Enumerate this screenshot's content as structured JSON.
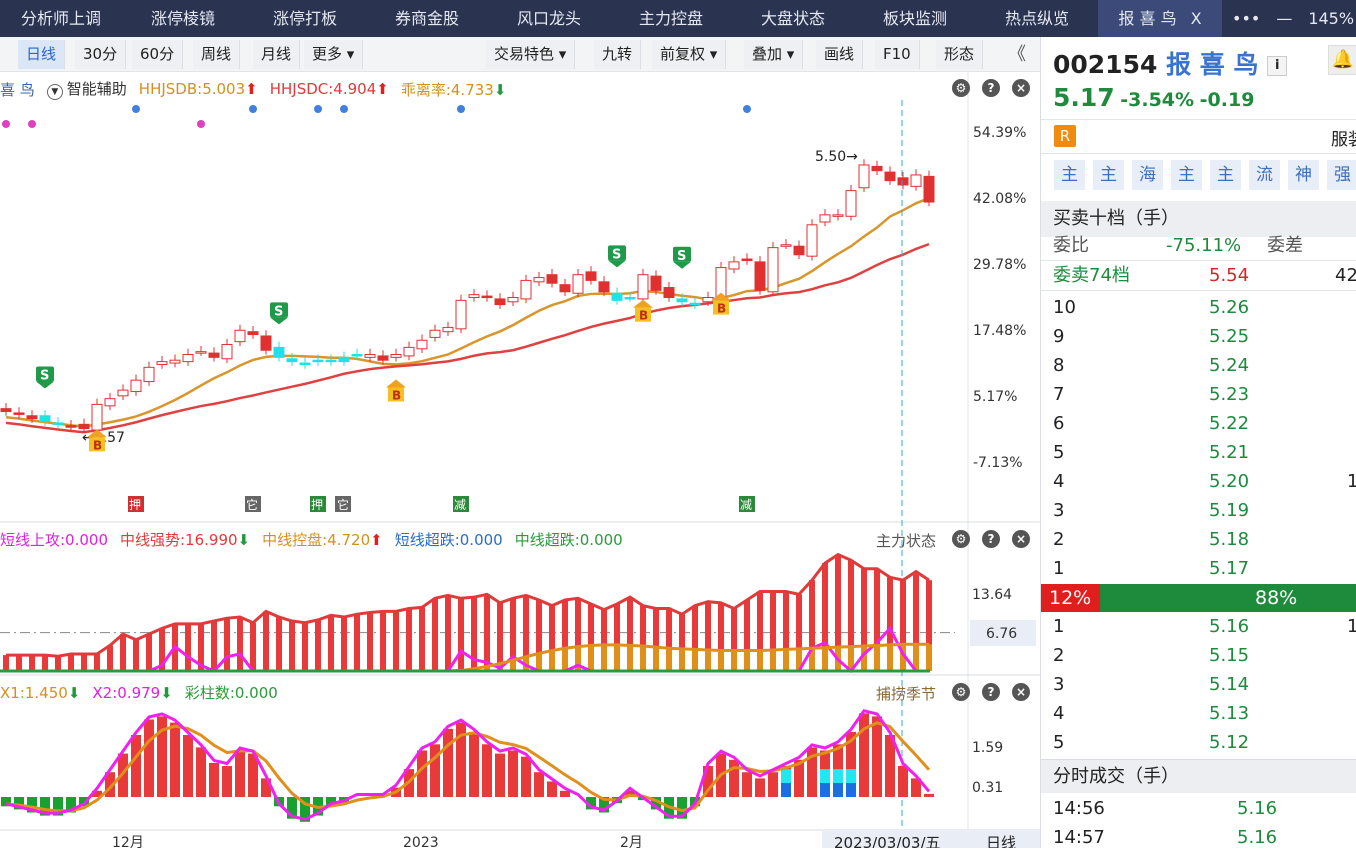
{
  "tabs": [
    "分析师上调",
    "涨停棱镜",
    "涨停打板",
    "券商金股",
    "风口龙头",
    "主力控盘",
    "大盘状态",
    "板块监测",
    "热点纵览"
  ],
  "active_tab": {
    "label": "报 喜 鸟",
    "close": "X"
  },
  "window": {
    "more": "•••",
    "minimize": "—",
    "zoom": "145%"
  },
  "toolbar": {
    "periods": [
      "日线",
      "30分",
      "60分",
      "周线",
      "月线",
      "更多 ▾"
    ],
    "right": [
      "交易特色 ▾",
      "九转",
      "前复权 ▾",
      "叠加 ▾",
      "画线",
      "F10",
      "形态"
    ],
    "collapse": "《"
  },
  "main_legend": {
    "name": "喜 鸟",
    "assist": "智能辅助",
    "items": [
      {
        "t": "HHJSDB:5.003",
        "c": "#d4901e",
        "arrow": "up"
      },
      {
        "t": "HHJSDC:4.904",
        "c": "#e03a3a",
        "arrow": "up"
      },
      {
        "t": "乖离率:4.733",
        "c": "#d4901e",
        "arrow": "down"
      }
    ]
  },
  "price_axis": [
    "54.39%",
    "42.08%",
    "29.78%",
    "17.48%",
    "5.17%",
    "-7.13%"
  ],
  "annotations": {
    "high": "5.50→",
    "low": "←3.57"
  },
  "signals": {
    "S": [
      3,
      21,
      47,
      52
    ],
    "B": [
      7,
      30,
      49,
      55
    ],
    "S_label": "S",
    "B_label": "B"
  },
  "bottom_tags": [
    {
      "t": "押",
      "c": "#d23030",
      "i": 10
    },
    {
      "t": "它",
      "c": "#666",
      "i": 19
    },
    {
      "t": "押",
      "c": "#2a8a3a",
      "i": 24
    },
    {
      "t": "它",
      "c": "#666",
      "i": 26
    },
    {
      "t": "减",
      "c": "#2a8a3a",
      "i": 35
    },
    {
      "t": "减",
      "c": "#2a8a3a",
      "i": 57
    }
  ],
  "panel2": {
    "title": "主力状态",
    "legend": [
      {
        "t": "短线上攻:0.000",
        "c": "#e020e0"
      },
      {
        "t": "中线强势:16.990",
        "c": "#e03a3a",
        "arrow": "down"
      },
      {
        "t": "中线控盘:4.720",
        "c": "#d4901e",
        "arrow": "up"
      },
      {
        "t": "短线超跌:0.000",
        "c": "#2a6cc8"
      },
      {
        "t": "中线超跌:0.000",
        "c": "#2a9a3a"
      }
    ],
    "axis": [
      "13.64",
      "6.76"
    ]
  },
  "panel3": {
    "title": "捕捞季节",
    "legend": [
      {
        "t": "X1:1.450",
        "c": "#d4901e",
        "arrow": "down"
      },
      {
        "t": "X2:0.979",
        "c": "#e020e0",
        "arrow": "down"
      },
      {
        "t": "彩柱数:0.000",
        "c": "#2a9a3a"
      }
    ],
    "axis": [
      "1.59",
      "0.31"
    ]
  },
  "date_axis": {
    "labels": [
      "12月",
      "2023",
      "2月"
    ],
    "cursor_date": "2023/03/03/五",
    "period": "日线"
  },
  "chart_data": {
    "type": "candlestick",
    "closes": [
      3.7,
      3.68,
      3.65,
      3.63,
      3.61,
      3.59,
      3.58,
      3.75,
      3.79,
      3.85,
      3.92,
      4.01,
      4.05,
      4.06,
      4.1,
      4.12,
      4.08,
      4.17,
      4.27,
      4.24,
      4.13,
      4.08,
      4.05,
      4.03,
      4.06,
      4.06,
      4.08,
      4.09,
      4.1,
      4.06,
      4.1,
      4.15,
      4.2,
      4.27,
      4.29,
      4.48,
      4.52,
      4.5,
      4.45,
      4.5,
      4.62,
      4.64,
      4.6,
      4.54,
      4.66,
      4.62,
      4.54,
      4.48,
      4.5,
      4.66,
      4.55,
      4.5,
      4.47,
      4.45,
      4.5,
      4.71,
      4.75,
      4.76,
      4.55,
      4.85,
      4.87,
      4.8,
      5.01,
      5.08,
      5.08,
      5.25,
      5.43,
      5.39,
      5.32,
      5.29,
      5.36,
      5.17
    ],
    "cyan_candles": [
      3,
      4,
      21,
      22,
      23,
      24,
      25,
      26,
      27,
      47,
      48,
      52,
      53
    ],
    "high_label": 5.5,
    "low_label": 3.57,
    "panel2_red": [
      2.8,
      2.8,
      2.8,
      2.8,
      2.6,
      3,
      3,
      3,
      4.5,
      6.5,
      5.5,
      6.5,
      7.5,
      8.3,
      8.3,
      8.3,
      8.8,
      9.3,
      9.5,
      8.5,
      10.5,
      9.5,
      8.8,
      8.5,
      9,
      9.8,
      9.5,
      10,
      10.3,
      10.5,
      10.5,
      11,
      11.2,
      12.8,
      13.3,
      12.8,
      13,
      13.5,
      12,
      12.8,
      13.3,
      12.5,
      11.5,
      12.5,
      12.8,
      11.8,
      10.8,
      11.8,
      13,
      11.5,
      11,
      11,
      10,
      11.5,
      12.2,
      12,
      11,
      12.5,
      14,
      14,
      14,
      13.5,
      16,
      19,
      20.5,
      19.5,
      18,
      18,
      16.5,
      16,
      17.5,
      16
    ],
    "panel2_magenta": [
      0,
      0,
      0,
      0,
      0,
      0,
      0,
      0,
      0,
      0,
      0,
      0,
      1,
      4.3,
      2.5,
      1,
      0,
      2.5,
      3,
      0,
      0,
      0,
      0,
      0,
      0,
      0,
      0,
      0,
      0,
      0,
      0,
      0,
      0,
      0,
      0,
      3.5,
      2,
      1.5,
      0.5,
      2.5,
      1,
      0,
      0,
      0,
      1,
      0,
      0,
      0,
      0,
      0,
      0,
      0,
      0,
      0,
      0,
      0,
      0,
      0,
      0,
      0,
      0,
      0,
      4,
      5,
      2,
      0,
      3,
      5,
      7.5,
      3,
      0,
      0
    ],
    "panel2_orange": [
      0,
      0,
      0,
      0,
      0,
      0,
      0,
      0,
      0,
      0,
      0,
      0,
      0,
      0,
      0,
      0,
      0,
      0,
      0,
      0,
      0,
      0,
      0,
      0,
      0,
      0,
      0,
      0,
      0,
      0,
      0,
      0,
      0,
      0,
      0,
      0.1,
      0.4,
      0.8,
      1.3,
      1.9,
      2.5,
      3.1,
      3.6,
      4,
      4.3,
      4.5,
      4.6,
      4.6,
      4.5,
      4.4,
      4.2,
      4,
      3.9,
      3.8,
      3.7,
      3.6,
      3.6,
      3.6,
      3.6,
      3.7,
      3.8,
      3.9,
      4,
      4.1,
      4.2,
      4.3,
      4.4,
      4.5,
      4.6,
      4.7,
      4.7,
      4.72
    ],
    "panel3_bars": [
      -0.3,
      -0.4,
      -0.5,
      -0.6,
      -0.6,
      -0.5,
      -0.3,
      0.2,
      0.8,
      1.4,
      2.0,
      2.5,
      2.6,
      2.4,
      2.0,
      1.6,
      1.1,
      1.0,
      1.5,
      1.4,
      0.6,
      -0.3,
      -0.7,
      -0.8,
      -0.6,
      -0.3,
      -0.2,
      0,
      0,
      0,
      0.3,
      0.9,
      1.5,
      1.7,
      2.2,
      2.4,
      2.1,
      1.7,
      1.4,
      1.5,
      1.3,
      0.8,
      0.5,
      0.2,
      0,
      -0.4,
      -0.5,
      -0.2,
      0.2,
      -0.1,
      -0.4,
      -0.7,
      -0.7,
      -0.3,
      1.0,
      1.4,
      1.2,
      0.8,
      0.6,
      0.8,
      1.0,
      1.2,
      1.6,
      1.5,
      1.7,
      2.1,
      2.7,
      2.6,
      2.0,
      1.0,
      0.6,
      0.1
    ]
  },
  "quote": {
    "code": "002154",
    "name": "报 喜 鸟",
    "info": "i",
    "price": "5.17",
    "pct": "-3.54%",
    "chg": "-0.19",
    "r_badge": "R",
    "industry": "服装",
    "chips": [
      "主",
      "主",
      "海",
      "主",
      "主",
      "流",
      "神",
      "强"
    ]
  },
  "order_book": {
    "title": "买卖十档（手）",
    "wb_label": "委比",
    "wb": "-75.11%",
    "wc_label": "委差",
    "ask_label": "委卖74档",
    "ask_price": "5.54",
    "ask_vol": "42",
    "asks": [
      {
        "n": "10",
        "p": "5.26"
      },
      {
        "n": "9",
        "p": "5.25"
      },
      {
        "n": "8",
        "p": "5.24"
      },
      {
        "n": "7",
        "p": "5.23"
      },
      {
        "n": "6",
        "p": "5.22"
      },
      {
        "n": "5",
        "p": "5.21"
      },
      {
        "n": "4",
        "p": "5.20",
        "v": "1"
      },
      {
        "n": "3",
        "p": "5.19"
      },
      {
        "n": "2",
        "p": "5.18"
      },
      {
        "n": "1",
        "p": "5.17"
      }
    ],
    "ratio_buy": "12%",
    "ratio_sell": "88%",
    "buy_fraction": 0.12,
    "bids": [
      {
        "n": "1",
        "p": "5.16",
        "v": "1"
      },
      {
        "n": "2",
        "p": "5.15"
      },
      {
        "n": "3",
        "p": "5.14"
      },
      {
        "n": "4",
        "p": "5.13"
      },
      {
        "n": "5",
        "p": "5.12"
      }
    ]
  },
  "ticks": {
    "title": "分时成交（手）",
    "rows": [
      {
        "t": "14:56",
        "p": "5.16"
      },
      {
        "t": "14:57",
        "p": "5.16"
      }
    ]
  }
}
